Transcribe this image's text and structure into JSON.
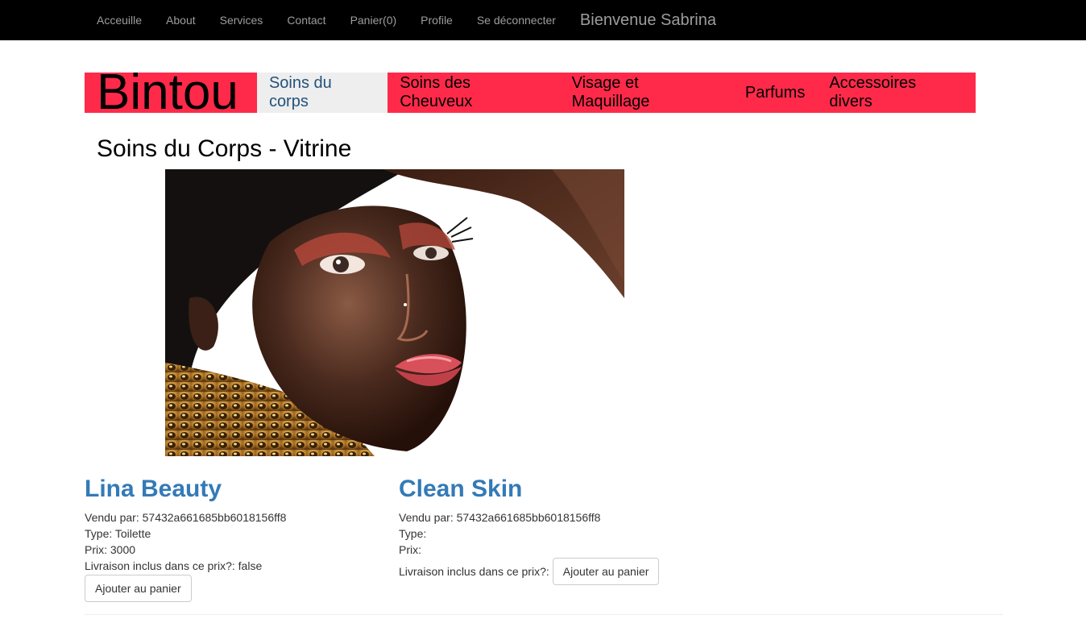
{
  "topnav": {
    "items": [
      {
        "label": "Acceuille"
      },
      {
        "label": "About"
      },
      {
        "label": "Services"
      },
      {
        "label": "Contact"
      },
      {
        "label": "Panier(0)"
      },
      {
        "label": "Profile"
      },
      {
        "label": "Se déconnecter"
      }
    ],
    "welcome": "Bienvenue Sabrina",
    "bg_color": "#000000"
  },
  "brandbar": {
    "brand": "Bintou",
    "accent_color": "#ff2a4a",
    "categories": [
      {
        "label": "Soins du corps",
        "active": true
      },
      {
        "label": "Soins des Cheuveux",
        "active": false
      },
      {
        "label": "Visage et Maquillage",
        "active": false
      },
      {
        "label": "Parfums",
        "active": false
      },
      {
        "label": "Accessoires divers",
        "active": false
      }
    ]
  },
  "page": {
    "title": "Soins du Corps - Vitrine"
  },
  "products": [
    {
      "name": "Lina Beauty",
      "seller_label": "Vendu par:",
      "seller": "57432a661685bb6018156ff8",
      "type_label": "Type:",
      "type": "Toilette",
      "price_label": "Prix:",
      "price": "3000",
      "delivery_label": "Livraison inclus dans ce prix?:",
      "delivery": "false",
      "add_button": "Ajouter au panier"
    },
    {
      "name": "Clean Skin",
      "seller_label": "Vendu par:",
      "seller": "57432a661685bb6018156ff8",
      "type_label": "Type:",
      "type": "",
      "price_label": "Prix:",
      "price": "",
      "delivery_label": "Livraison inclus dans ce prix?:",
      "delivery": "",
      "add_button": "Ajouter au panier"
    }
  ]
}
